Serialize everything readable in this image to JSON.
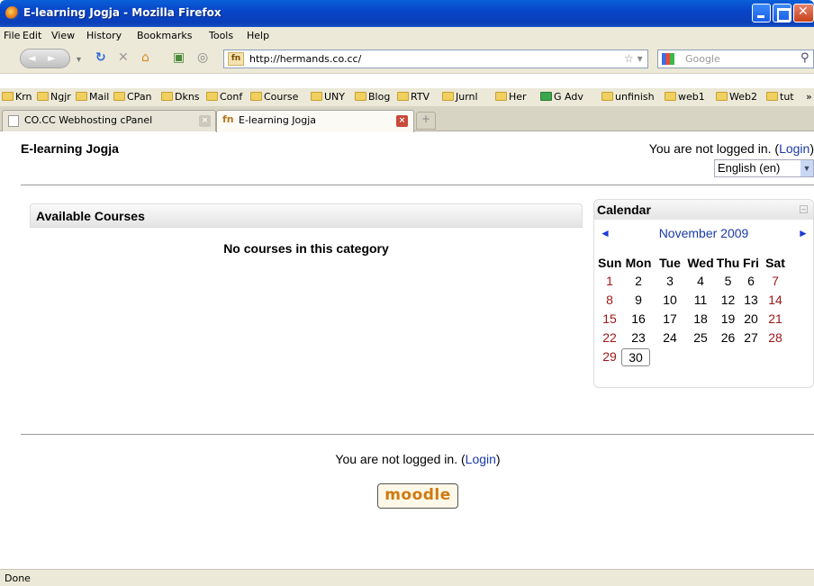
{
  "window": {
    "title": "E-learning Jogja - Mozilla Firefox"
  },
  "menu": [
    "File",
    "Edit",
    "View",
    "History",
    "Bookmarks",
    "Tools",
    "Help"
  ],
  "nav": {
    "url": "http://hermands.co.cc/",
    "search_placeholder": "Google"
  },
  "bookmarks": [
    "Krn",
    "Ngjr",
    "Mail",
    "CPan",
    "Dkns",
    "Conf",
    "Course",
    "UNY",
    "Blog",
    "RTV",
    "Jurnl",
    "Her",
    "G Adv",
    "unfinish",
    "web1",
    "Web2",
    "tut",
    "»"
  ],
  "tabs": [
    {
      "label": "CO.CC Webhosting cPanel"
    },
    {
      "label": "E-learning Jogja"
    }
  ],
  "page": {
    "site_title": "E-learning Jogja",
    "login_prefix": "You are not logged in. (",
    "login_link": "Login",
    "login_suffix": ")",
    "language": "English (en)",
    "available_courses": "Available Courses",
    "no_courses": "No courses in this category",
    "footer_login_prefix": "You are not logged in. (",
    "footer_login_link": "Login",
    "footer_login_suffix": ")",
    "logo_text": "moodle"
  },
  "calendar": {
    "title": "Calendar",
    "month": "November 2009",
    "prev": "◄",
    "next": "►",
    "weekdays": [
      "Sun",
      "Mon",
      "Tue",
      "Wed",
      "Thu",
      "Fri",
      "Sat"
    ],
    "weeks": [
      [
        "1",
        "2",
        "3",
        "4",
        "5",
        "6",
        "7"
      ],
      [
        "8",
        "9",
        "10",
        "11",
        "12",
        "13",
        "14"
      ],
      [
        "15",
        "16",
        "17",
        "18",
        "19",
        "20",
        "21"
      ],
      [
        "22",
        "23",
        "24",
        "25",
        "26",
        "27",
        "28"
      ],
      [
        "29",
        "30",
        "",
        "",
        "",
        "",
        ""
      ]
    ],
    "today": "30"
  },
  "status": "Done",
  "colors": {
    "link": "#1a3aa8",
    "weekend": "#a01818",
    "titlebar": "#0845c8"
  }
}
